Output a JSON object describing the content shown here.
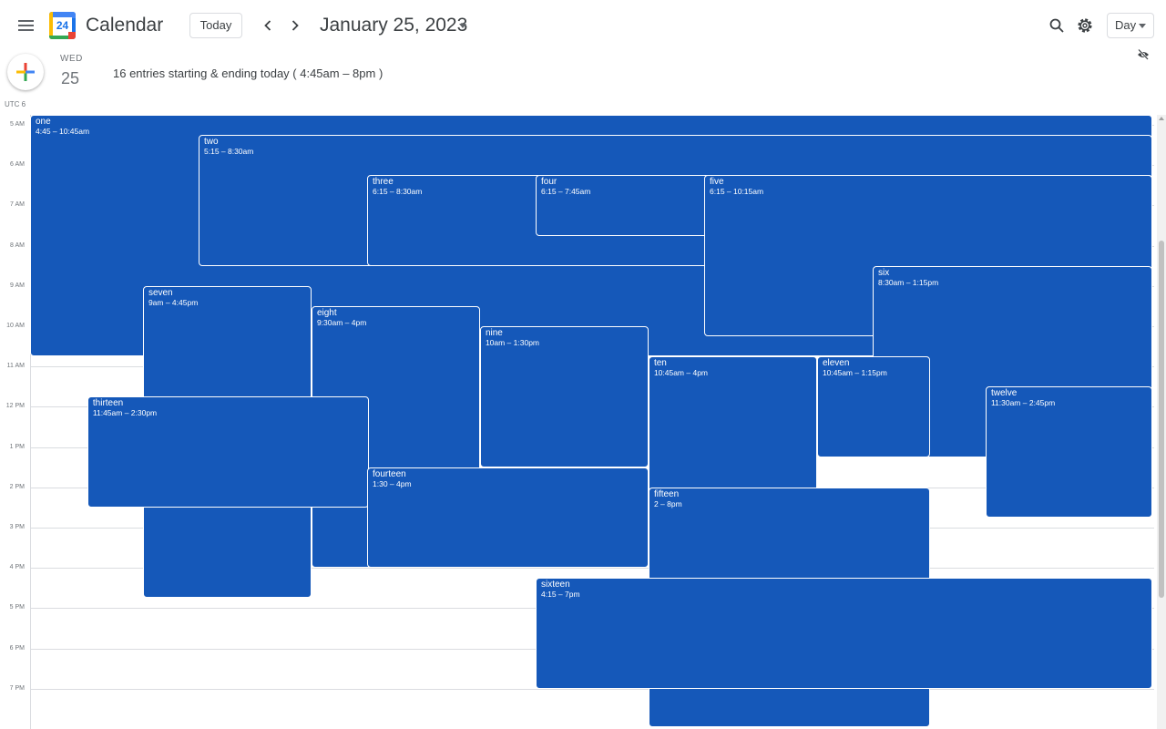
{
  "header": {
    "app_title": "Calendar",
    "logo_number": "24",
    "today_label": "Today",
    "date_title": "January 25, 2023",
    "view_label": "Day"
  },
  "day": {
    "name": "WED",
    "number": "25"
  },
  "summary": "16 entries starting & ending today ( 4:45am – 8pm )",
  "timezone": "UTC 6",
  "hours": [
    "5 AM",
    "6 AM",
    "7 AM",
    "8 AM",
    "9 AM",
    "10 AM",
    "11 AM",
    "12 PM",
    "1 PM",
    "2 PM",
    "3 PM",
    "4 PM",
    "5 PM",
    "6 PM",
    "7 PM"
  ],
  "events": [
    {
      "title": "one",
      "time": "4:45 – 10:45am",
      "start": 4.75,
      "end": 10.75,
      "col": 0,
      "span": 7
    },
    {
      "title": "two",
      "time": "5:15 – 8:30am",
      "start": 5.25,
      "end": 8.5,
      "col": 1,
      "span": 6
    },
    {
      "title": "three",
      "time": "6:15 – 8:30am",
      "start": 6.25,
      "end": 8.5,
      "col": 2,
      "span": 5
    },
    {
      "title": "four",
      "time": "6:15 – 7:45am",
      "start": 6.25,
      "end": 7.75,
      "col": 3,
      "span": 4
    },
    {
      "title": "five",
      "time": "6:15 – 10:15am",
      "start": 6.25,
      "end": 10.25,
      "col": 4,
      "span": 3
    },
    {
      "title": "six",
      "time": "8:30am – 1:15pm",
      "start": 8.5,
      "end": 13.25,
      "col": 5,
      "span": 2
    },
    {
      "title": "seven",
      "time": "9am – 4:45pm",
      "start": 9.0,
      "end": 16.75,
      "col": 0.67,
      "span": 1
    },
    {
      "title": "eight",
      "time": "9:30am – 4pm",
      "start": 9.5,
      "end": 16.0,
      "col": 1.67,
      "span": 1
    },
    {
      "title": "nine",
      "time": "10am – 1:30pm",
      "start": 10.0,
      "end": 13.5,
      "col": 2.67,
      "span": 1
    },
    {
      "title": "ten",
      "time": "10:45am – 4pm",
      "start": 10.75,
      "end": 16.0,
      "col": 3.67,
      "span": 1
    },
    {
      "title": "eleven",
      "time": "10:45am – 1:15pm",
      "start": 10.75,
      "end": 13.25,
      "col": 4.67,
      "span": 0.67
    },
    {
      "title": "twelve",
      "time": "11:30am – 2:45pm",
      "start": 11.5,
      "end": 14.75,
      "col": 5.67,
      "span": 1
    },
    {
      "title": "thirteen",
      "time": "11:45am – 2:30pm",
      "start": 11.75,
      "end": 14.5,
      "col": 0.34,
      "span": 1.67
    },
    {
      "title": "fourteen",
      "time": "1:30 – 4pm",
      "start": 13.5,
      "end": 16.0,
      "col": 2,
      "span": 1.67
    },
    {
      "title": "fifteen",
      "time": "2 – 8pm",
      "start": 14.0,
      "end": 20.0,
      "col": 3.67,
      "span": 1.67
    },
    {
      "title": "sixteen",
      "time": "4:15 – 7pm",
      "start": 16.25,
      "end": 19.0,
      "col": 3,
      "span": 3.67
    }
  ],
  "colors": {
    "event": "#1558b9",
    "text": "#3c4043",
    "grid": "#dadce0"
  }
}
